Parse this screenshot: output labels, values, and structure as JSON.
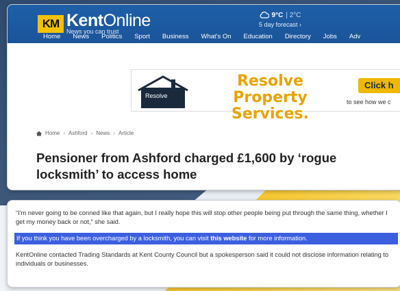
{
  "colors": {
    "header_blue": "#1e5fa8",
    "logo_yellow": "#f6c200",
    "ad_gold": "#e8a300",
    "highlight_blue": "#3c5fe0"
  },
  "header": {
    "logo_badge": "KM",
    "logo_name_bold": "Kent",
    "logo_name_thin": "Online",
    "logo_tagline": "News you can trust",
    "weather_icon": "cloud-icon",
    "weather_temp": "9°C",
    "weather_range": "| 2°C",
    "weather_forecast": "5 day forecast ›"
  },
  "nav": [
    "Home",
    "News",
    "Politics",
    "Sport",
    "Business",
    "What's On",
    "Education",
    "Directory",
    "Jobs",
    "Adv"
  ],
  "ad": {
    "brand": "Resolve",
    "brand_sub": "Property Services",
    "title": "Resolve Property Services.",
    "cta": "Click h",
    "cta_sub": "to see how we c"
  },
  "breadcrumb": [
    "Home",
    "Ashford",
    "News",
    "Article"
  ],
  "headline": "Pensioner from Ashford charged £1,600 by ‘rogue locksmith’ to access home",
  "body": {
    "para1": "“I'm never going to be conned like that again, but I really hope this will stop other people being put through the same thing, whether I get my money back or not,” she said.",
    "para2_before": "If you think you have been overcharged by a locksmith, you can visit ",
    "para2_link": "this website",
    "para2_after": " for more information.",
    "para3": "KentOnline contacted Trading Standards at Kent County Council but a spokesperson said it could not disclose information relating to individuals or businesses."
  }
}
